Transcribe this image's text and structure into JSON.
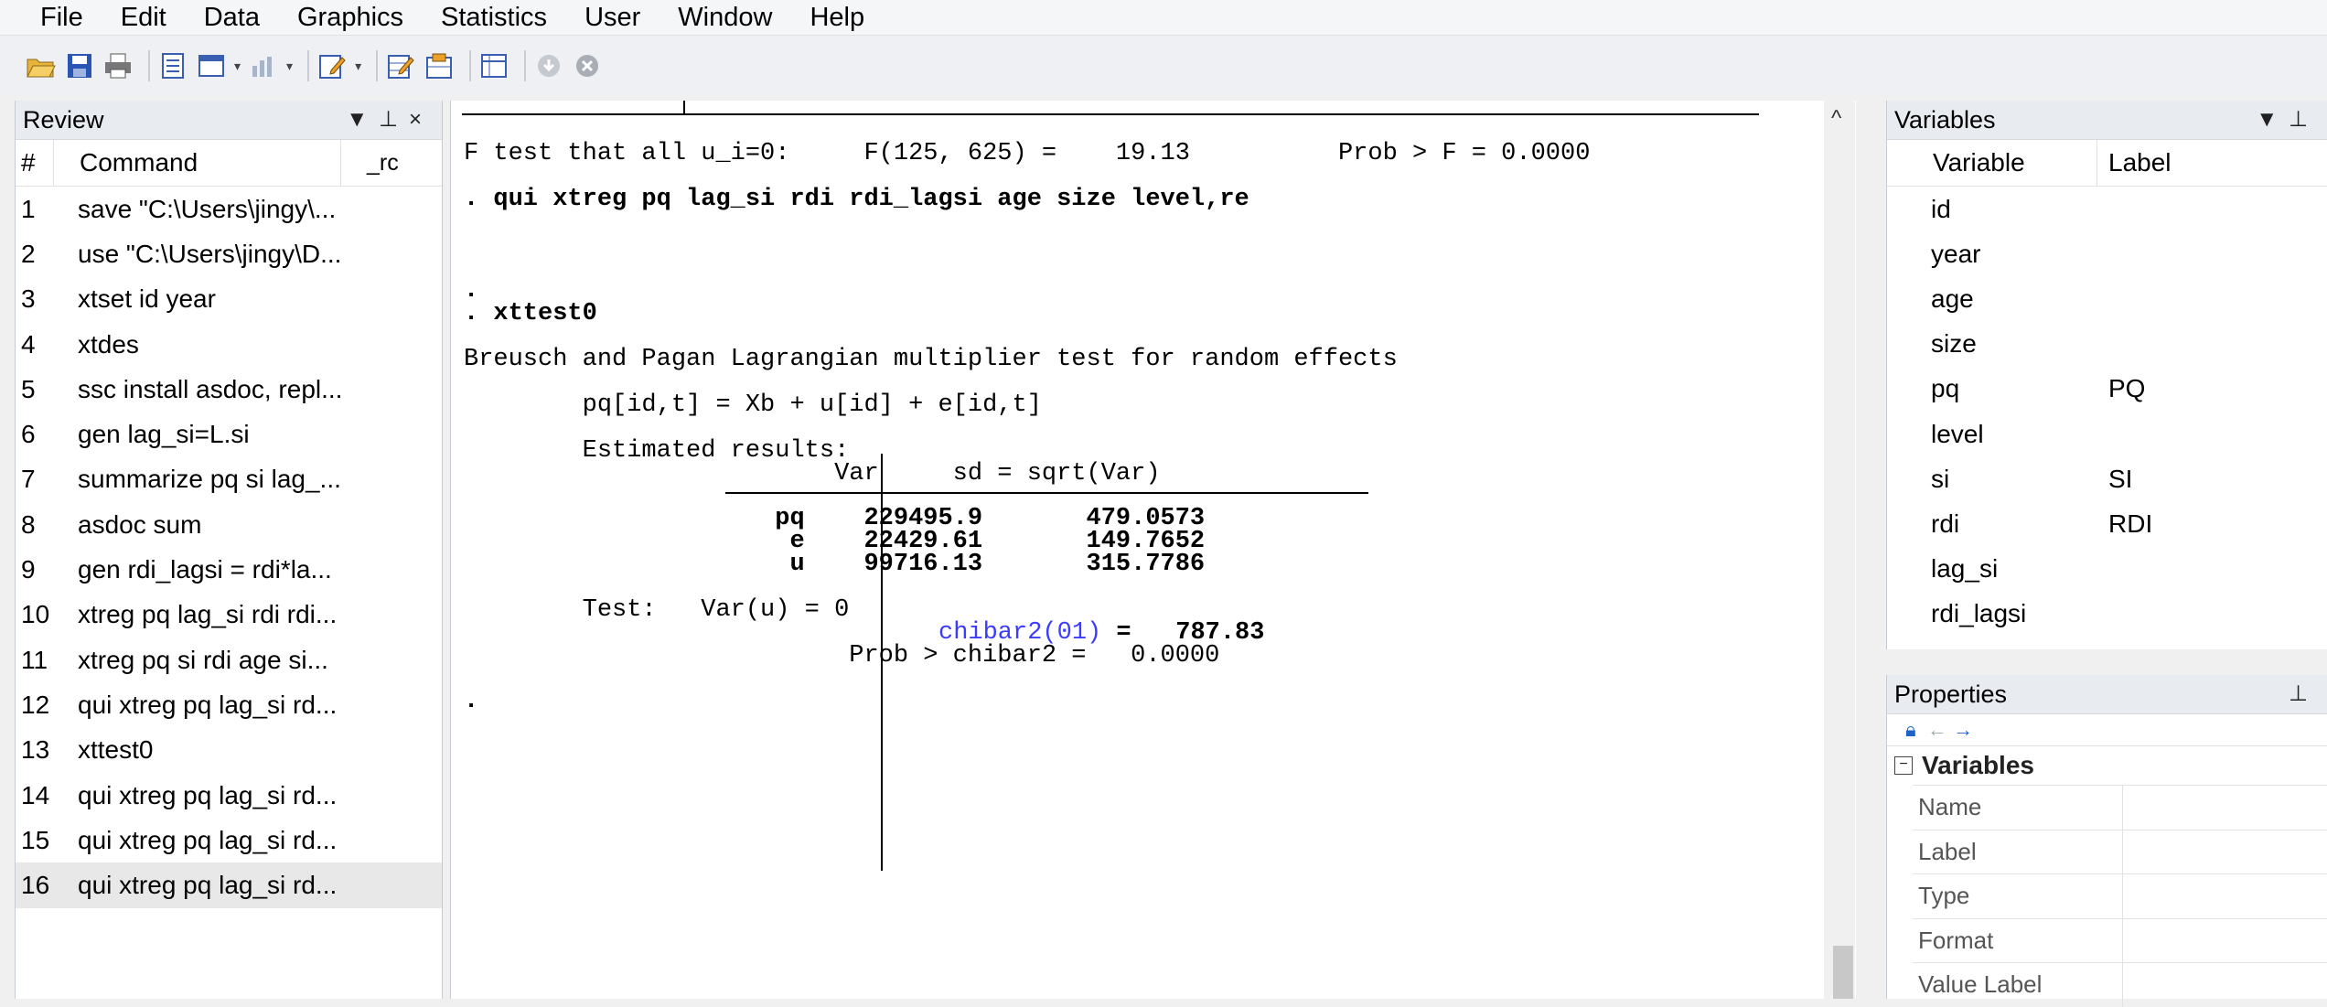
{
  "menu": [
    "File",
    "Edit",
    "Data",
    "Graphics",
    "Statistics",
    "User",
    "Window",
    "Help"
  ],
  "toolbar": {
    "icons": [
      "open-icon",
      "save-icon",
      "print-icon",
      "log-icon",
      "viewer-icon",
      "graph-icon",
      "do-file-editor-icon",
      "data-editor-icon",
      "data-browser-icon",
      "variables-manager-icon",
      "more-icon",
      "break-icon"
    ]
  },
  "review": {
    "title": "Review",
    "controls": "T ᵖ ×",
    "col_num": "#",
    "col_command": "Command",
    "col_rc": "_rc",
    "rows": [
      {
        "n": "1",
        "cmd": "save \"C:\\Users\\jingy\\..."
      },
      {
        "n": "2",
        "cmd": "use \"C:\\Users\\jingy\\D..."
      },
      {
        "n": "3",
        "cmd": "xtset id year"
      },
      {
        "n": "4",
        "cmd": "xtdes"
      },
      {
        "n": "5",
        "cmd": "ssc install asdoc, repl..."
      },
      {
        "n": "6",
        "cmd": "gen lag_si=L.si"
      },
      {
        "n": "7",
        "cmd": "summarize pq si lag_..."
      },
      {
        "n": "8",
        "cmd": "asdoc sum"
      },
      {
        "n": "9",
        "cmd": "gen rdi_lagsi = rdi*la..."
      },
      {
        "n": "10",
        "cmd": "xtreg pq lag_si rdi rdi..."
      },
      {
        "n": "11",
        "cmd": "xtreg pq si rdi age si..."
      },
      {
        "n": "12",
        "cmd": "qui xtreg pq lag_si rd..."
      },
      {
        "n": "13",
        "cmd": "xttest0"
      },
      {
        "n": "14",
        "cmd": "qui xtreg pq lag_si rd..."
      },
      {
        "n": "15",
        "cmd": "qui xtreg pq lag_si rd..."
      },
      {
        "n": "16",
        "cmd": "qui xtreg pq lag_si rd..."
      }
    ]
  },
  "results": {
    "ftest": "F test that all u_i=0:     F(125, 625) =    19.13          Prob > F = 0.0000",
    "cmd1": ". qui xtreg pq lag_si rdi rdi_lagsi age size level,re",
    "dot1": ".",
    "cmd2": ". xttest0",
    "bp_title": "Breusch and Pagan Lagrangian multiplier test for random effects",
    "model": "        pq[id,t] = Xb + u[id] + e[id,t]",
    "est": "        Estimated results:",
    "thead": "                         Var     sd = sqrt(Var)",
    "r_pq": "                     pq    229495.9       479.0573",
    "r_e": "                      e    22429.61       149.7652",
    "r_u": "                      u    99716.13       315.7786",
    "test": "        Test:   Var(u) = 0",
    "chibar_label": "chibar2(01)",
    "chibar_eq": " =   787.83",
    "prob": "                          Prob > chibar2 =   0.0000",
    "dot2": "."
  },
  "variables": {
    "title": "Variables",
    "controls": "T ᵖ",
    "col_variable": "Variable",
    "col_label": "Label",
    "rows": [
      {
        "name": "id",
        "label": ""
      },
      {
        "name": "year",
        "label": ""
      },
      {
        "name": "age",
        "label": ""
      },
      {
        "name": "size",
        "label": ""
      },
      {
        "name": "pq",
        "label": "PQ"
      },
      {
        "name": "level",
        "label": ""
      },
      {
        "name": "si",
        "label": "SI"
      },
      {
        "name": "rdi",
        "label": "RDI"
      },
      {
        "name": "lag_si",
        "label": ""
      },
      {
        "name": "rdi_lagsi",
        "label": ""
      }
    ]
  },
  "properties": {
    "title": "Properties",
    "controls": "ᵖ",
    "group": "Variables",
    "rows": [
      "Name",
      "Label",
      "Type",
      "Format",
      "Value Label"
    ]
  }
}
